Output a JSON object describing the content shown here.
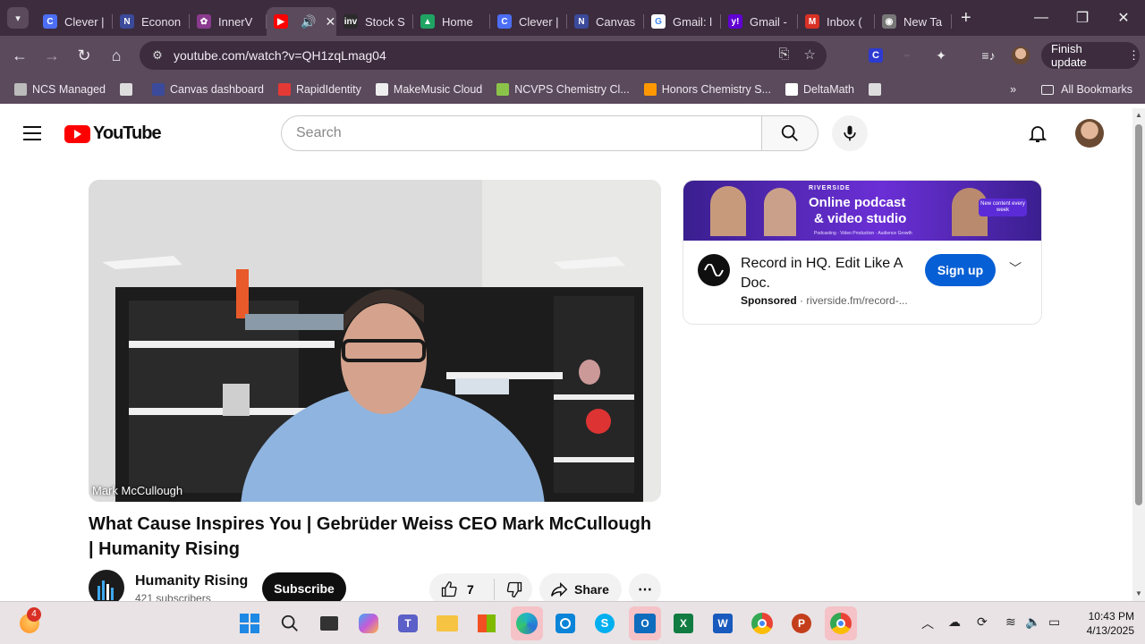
{
  "browser": {
    "tabs": [
      {
        "label": "Clever |",
        "favicon": "C",
        "color": "#4c6ef5"
      },
      {
        "label": "Econon",
        "favicon": "N",
        "color": "#3b4a9a"
      },
      {
        "label": "InnerV",
        "favicon": "✿",
        "color": "#8a3b8f"
      },
      {
        "label": "",
        "favicon": "▶",
        "color": "#ff0000",
        "active": true
      },
      {
        "label": "Stock S",
        "favicon": "inv",
        "color": "#2b2b2b"
      },
      {
        "label": "Home",
        "favicon": "▲",
        "color": "#1fa463"
      },
      {
        "label": "Clever |",
        "favicon": "C",
        "color": "#4c6ef5"
      },
      {
        "label": "Canvas",
        "favicon": "N",
        "color": "#3b4a9a"
      },
      {
        "label": "Gmail: l",
        "favicon": "G",
        "color": "#ffffff"
      },
      {
        "label": "Gmail -",
        "favicon": "y!",
        "color": "#6001d2"
      },
      {
        "label": "Inbox (",
        "favicon": "M",
        "color": "#d93025"
      },
      {
        "label": "New Ta",
        "favicon": "◉",
        "color": "#777777"
      }
    ],
    "url": "youtube.com/watch?v=QH1zqLmag04",
    "update_label": "Finish update",
    "bookmarks": [
      {
        "label": "NCS Managed",
        "color": "#bbbbbb"
      },
      {
        "label": "",
        "color": "#dddddd"
      },
      {
        "label": "Canvas dashboard",
        "color": "#3b4a9a"
      },
      {
        "label": "RapidIdentity",
        "color": "#e53935"
      },
      {
        "label": "MakeMusic Cloud",
        "color": "#eeeeee"
      },
      {
        "label": "NCVPS Chemistry Cl...",
        "color": "#8bc34a"
      },
      {
        "label": "Honors Chemistry S...",
        "color": "#ff9800"
      },
      {
        "label": "DeltaMath",
        "color": "#ffffff"
      },
      {
        "label": "",
        "color": "#dddddd"
      }
    ],
    "all_bookmarks": "All Bookmarks"
  },
  "youtube": {
    "logo_text": "YouTube",
    "search_placeholder": "Search",
    "video": {
      "name_overlay": "Mark McCullough",
      "title": "What Cause Inspires You | Gebrüder Weiss CEO Mark McCullough | Humanity Rising",
      "channel": "Humanity Rising",
      "subscribers": "421 subscribers",
      "subscribe_label": "Subscribe",
      "likes": "7",
      "share_label": "Share"
    },
    "ad": {
      "banner_brand": "RIVERSIDE",
      "banner_line1": "Online podcast",
      "banner_line2": "& video studio",
      "banner_tag": "New content every week",
      "banner_sub": "Podcasting · Video Production · Audience Growth",
      "title": "Record in HQ. Edit Like A Doc.",
      "sponsored": "Sponsored",
      "domain": "· riverside.fm/record-...",
      "cta": "Sign up"
    }
  },
  "taskbar": {
    "badge": "4",
    "time": "10:43 PM",
    "date": "4/13/2025"
  }
}
